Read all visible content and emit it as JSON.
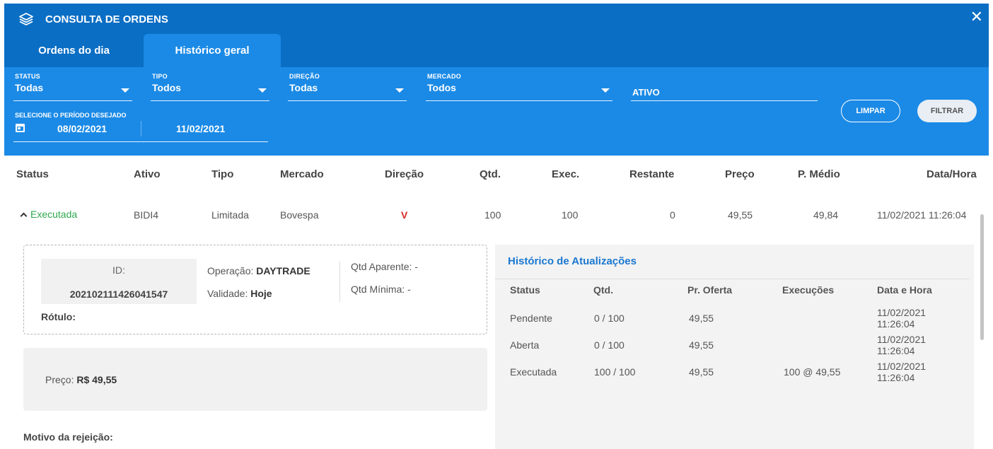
{
  "header": {
    "title": "CONSULTA DE ORDENS",
    "close": "✕"
  },
  "tabs": [
    {
      "label": "Ordens do dia"
    },
    {
      "label": "Histórico geral"
    }
  ],
  "filters": {
    "status": {
      "label": "STATUS",
      "value": "Todas"
    },
    "tipo": {
      "label": "TIPO",
      "value": "Todos"
    },
    "direcao": {
      "label": "DIREÇÃO",
      "value": "Todas"
    },
    "mercado": {
      "label": "MERCADO",
      "value": "Todos"
    },
    "ativo": {
      "placeholder": "ATIVO"
    },
    "period": {
      "label": "SELECIONE O PERÍODO DESEJADO",
      "start": "08/02/2021",
      "end": "11/02/2021"
    },
    "clear_label": "LIMPAR",
    "filter_label": "FILTRAR"
  },
  "table": {
    "columns": [
      "Status",
      "Ativo",
      "Tipo",
      "Mercado",
      "Direção",
      "Qtd.",
      "Exec.",
      "Restante",
      "Preço",
      "P. Médio",
      "Data/Hora"
    ],
    "row": {
      "status": "Executada",
      "ativo": "BIDI4",
      "tipo": "Limitada",
      "mercado": "Bovespa",
      "direcao": "V",
      "qtd": "100",
      "exec": "100",
      "restante": "0",
      "preco": "49,55",
      "p_medio": "49,84",
      "data_hora": "11/02/2021 11:26:04"
    }
  },
  "detail": {
    "id_label": "ID:",
    "id_value": "202102111426041547",
    "rotulo_label": "Rótulo:",
    "operacao_label": "Operação:",
    "operacao_value": "DAYTRADE",
    "validade_label": "Validade:",
    "validade_value": "Hoje",
    "qtd_aparente": "Qtd Aparente: -",
    "qtd_minima": "Qtd Mínima: -",
    "preco_label": "Preço:",
    "preco_value": "R$ 49,55",
    "motivo_label": "Motivo da rejeição:"
  },
  "history": {
    "title": "Histórico de Atualizações",
    "columns": [
      "Status",
      "Qtd.",
      "Pr. Oferta",
      "Execuções",
      "Data e Hora"
    ],
    "rows": [
      {
        "status": "Pendente",
        "qtd": "0 / 100",
        "oferta": "49,55",
        "execucoes": "",
        "data": "11/02/2021",
        "hora": "11:26:04"
      },
      {
        "status": "Aberta",
        "qtd": "0 / 100",
        "oferta": "49,55",
        "execucoes": "",
        "data": "11/02/2021",
        "hora": "11:26:04"
      },
      {
        "status": "Executada",
        "qtd": "100 / 100",
        "oferta": "49,55",
        "execucoes": "100 @ 49,55",
        "data": "11/02/2021",
        "hora": "11:26:04"
      }
    ]
  }
}
